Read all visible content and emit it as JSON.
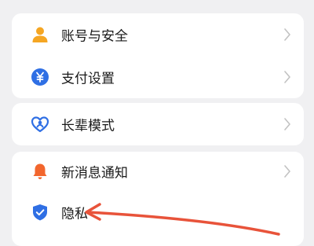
{
  "settings": {
    "group1": [
      {
        "label": "账号与安全",
        "icon": "person-icon",
        "icon_color": "#F5A623"
      },
      {
        "label": "支付设置",
        "icon": "yuan-icon",
        "icon_color": "#2F6FE4"
      }
    ],
    "group2": [
      {
        "label": "长辈模式",
        "icon": "heart-person-icon",
        "icon_color": "#2F6FE4"
      }
    ],
    "group3": [
      {
        "label": "新消息通知",
        "icon": "bell-icon",
        "icon_color": "#F2662D"
      },
      {
        "label": "隐私",
        "icon": "shield-check-icon",
        "icon_color": "#2F6FE4"
      }
    ]
  },
  "annotation": {
    "arrow_color": "#E8533A"
  }
}
